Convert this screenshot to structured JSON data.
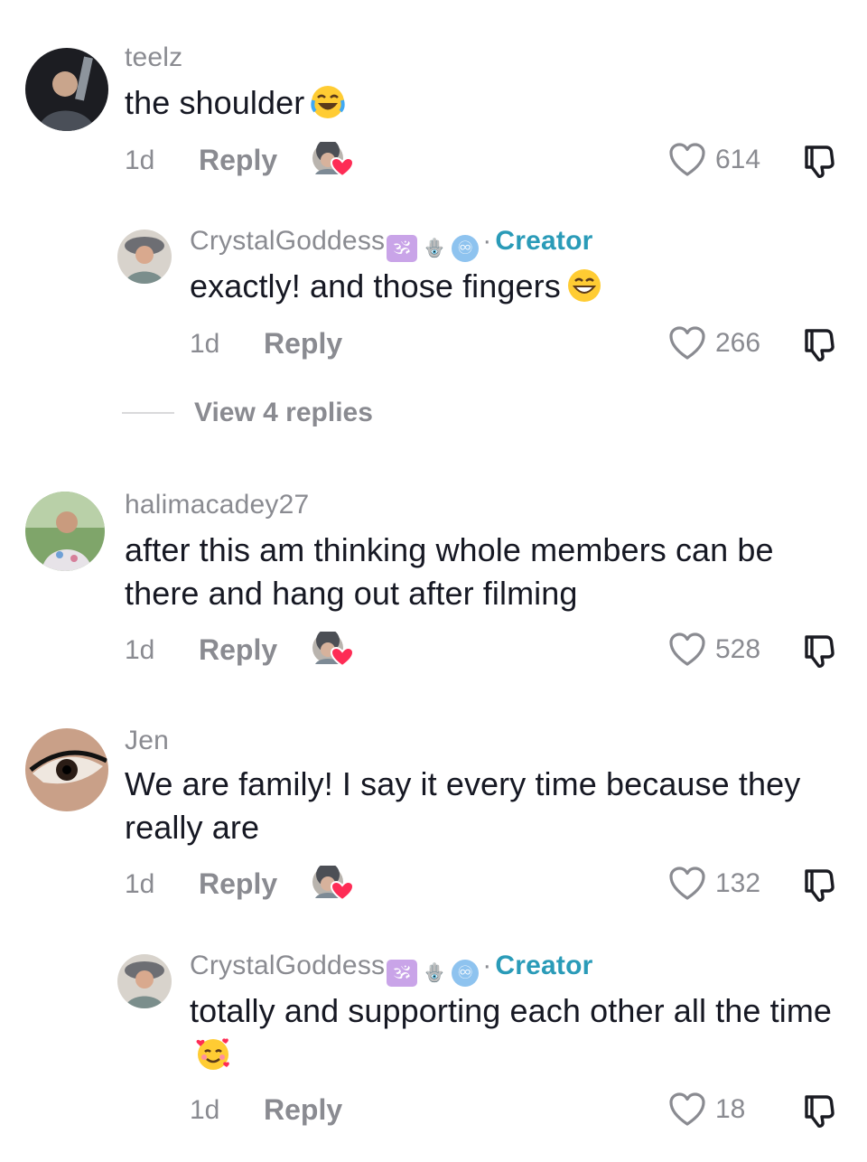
{
  "comments": [
    {
      "username": "teelz",
      "text": "the shoulder",
      "emoji": "😂",
      "time": "1d",
      "reply_label": "Reply",
      "likes": "614"
    },
    {
      "username": "CrystalGoddess",
      "badges": [
        "🕉",
        "🪬",
        "♾"
      ],
      "creator_label": "Creator",
      "separator": "·",
      "text": "exactly! and those fingers",
      "emoji": "😁",
      "time": "1d",
      "reply_label": "Reply",
      "likes": "266"
    },
    {
      "username": "halimacadey27",
      "text": "after this am thinking whole members can be there and hang out after filming",
      "time": "1d",
      "reply_label": "Reply",
      "likes": "528"
    },
    {
      "username": "Jen",
      "text": "We are family! I say it every time because they really are",
      "time": "1d",
      "reply_label": "Reply",
      "likes": "132"
    },
    {
      "username": "CrystalGoddess",
      "badges": [
        "🕉",
        "🪬",
        "♾"
      ],
      "creator_label": "Creator",
      "separator": "·",
      "text": "totally and supporting each other all the time",
      "emoji": "🥰",
      "time": "1d",
      "reply_label": "Reply",
      "likes": "18"
    }
  ],
  "view_replies": "View 4 replies",
  "colors": {
    "text": "#161823",
    "muted": "#8a8b91",
    "creator": "#2a9bb8",
    "heart": "#fe2c55"
  },
  "icons": {
    "like": "heart-outline-icon",
    "dislike": "thumbs-down-icon",
    "creator_liked": "creator-liked-heart-icon"
  }
}
